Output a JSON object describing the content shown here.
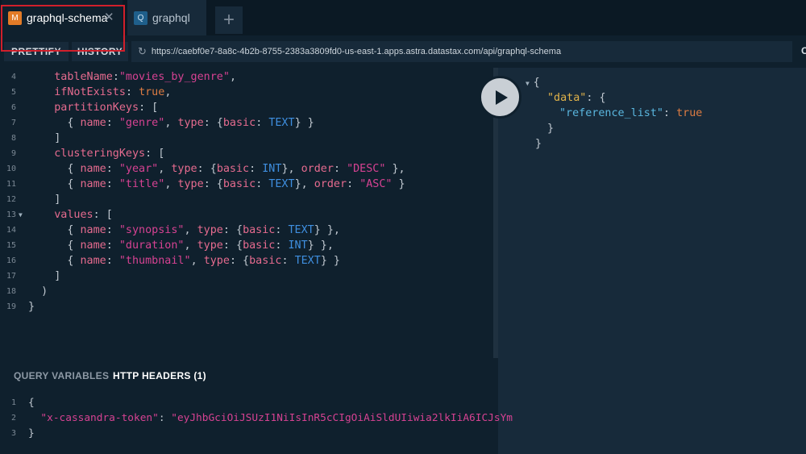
{
  "tabs": [
    {
      "badge": "M",
      "label": "graphql-schema",
      "close": "✕"
    },
    {
      "badge": "Q",
      "label": "graphql"
    }
  ],
  "add_tab": "+",
  "toolbar": {
    "prettify": "PRETTIFY",
    "history": "HISTORY",
    "url": "https://caebf0e7-8a8c-4b2b-8755-2383a3809fd0-us-east-1.apps.astra.datastax.com/api/graphql-schema",
    "extra": "C"
  },
  "editor": {
    "line_numbers": [
      "4",
      "5",
      "6",
      "7",
      "8",
      "9",
      "10",
      "11",
      "12",
      "13",
      "14",
      "15",
      "16",
      "17",
      "18",
      "19"
    ],
    "tokens": {
      "tableName": "tableName",
      "movies_by_genre": "\"movies_by_genre\"",
      "ifNotExists": "ifNotExists",
      "true": "true",
      "partitionKeys": "partitionKeys",
      "clusteringKeys": "clusteringKeys",
      "values": "values",
      "name": "name",
      "type": "type",
      "basic": "basic",
      "order": "order",
      "genre": "\"genre\"",
      "year": "\"year\"",
      "title": "\"title\"",
      "synopsis": "\"synopsis\"",
      "duration": "\"duration\"",
      "thumbnail": "\"thumbnail\"",
      "desc": "\"DESC\"",
      "asc": "\"ASC\"",
      "text": "TEXT",
      "int": "INT"
    }
  },
  "result": {
    "data_key": "\"data\"",
    "reference_list_key": "\"reference_list\"",
    "reference_list_value": "true"
  },
  "variables": {
    "tab_query_variables": "QUERY VARIABLES",
    "tab_http_headers": "HTTP HEADERS (1)",
    "line_numbers": [
      "1",
      "2",
      "3"
    ],
    "header_key": "\"x-cassandra-token\"",
    "header_value": "\"eyJhbGciOiJSUzI1NiIsInR5cCIgOiAiSldUIiwia2lkIiA6ICJsYm"
  },
  "colors": {
    "background": "#0f202d",
    "result_background": "#172a3a",
    "property": "#e66b8f",
    "string": "#d64292",
    "type": "#3f8fe0",
    "boolean": "#de7c42",
    "highlight_box": "#d11f2b"
  }
}
